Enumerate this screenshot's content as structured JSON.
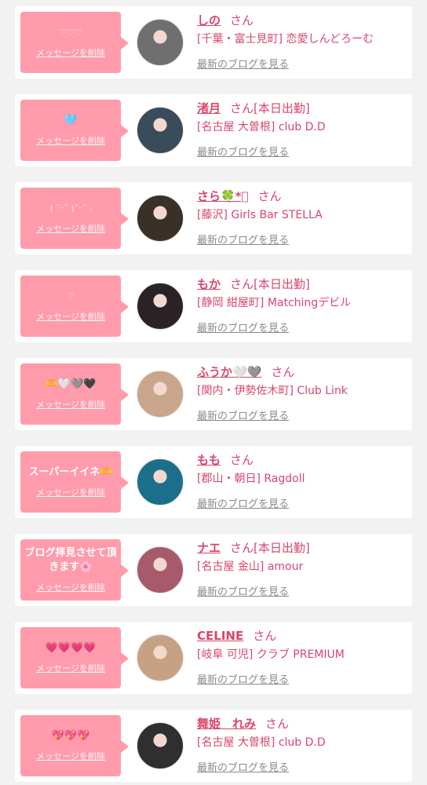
{
  "delete_label": "メッセージを削除",
  "blog_label": "最新のブログを見る",
  "honorific": "さん",
  "cards": [
    {
      "message": "♡♡♡",
      "small": true,
      "name": "しの",
      "status": "",
      "shop": "[千葉・富士見町] 恋愛しんどろーむ",
      "avatar_color": "#6f6f6f"
    },
    {
      "message": "🩵",
      "small": false,
      "name": "渚月",
      "status": "[本日出勤]",
      "shop": "[名古屋 大曽根] club D.D",
      "avatar_color": "#3a4b5a"
    },
    {
      "message": "( ˘ᵕ˘ )˘ᵕ˘ ₎",
      "small": true,
      "name": "さら🍀*ﾟ",
      "status": "",
      "shop": "[藤沢] Girls Bar STELLA",
      "avatar_color": "#3b3028"
    },
    {
      "message": "♡",
      "small": true,
      "name": "もか",
      "status": "[本日出勤]",
      "shop": "[静岡 紺屋町] Matchingデビル",
      "avatar_color": "#2b2226"
    },
    {
      "message": "🫶🤍🩶🖤",
      "small": false,
      "name": "ふうか🤍🩶",
      "status": "",
      "shop": "[関内・伊勢佐木町] Club Link",
      "avatar_color": "#c9a58c"
    },
    {
      "message": "スーパーイイネ🫶",
      "small": false,
      "name": "もも",
      "status": "",
      "shop": "[郡山・朝日] Ragdoll",
      "avatar_color": "#1b6f8a"
    },
    {
      "message": "ブログ拝見させて頂きます🌸",
      "small": false,
      "name": "ナエ",
      "status": "[本日出勤]",
      "shop": "[名古屋 金山] amour",
      "avatar_color": "#a85a6a"
    },
    {
      "message": "💗💗💗💗",
      "small": false,
      "name": "CELINE",
      "status": "",
      "shop": "[岐阜 可児] クラブ PREMIUM",
      "avatar_color": "#c7a184"
    },
    {
      "message": "💖💖💖",
      "small": false,
      "name": "舞姫　れみ",
      "status": "",
      "shop": "[名古屋 大曽根] club D.D",
      "avatar_color": "#2f2f2f"
    }
  ]
}
